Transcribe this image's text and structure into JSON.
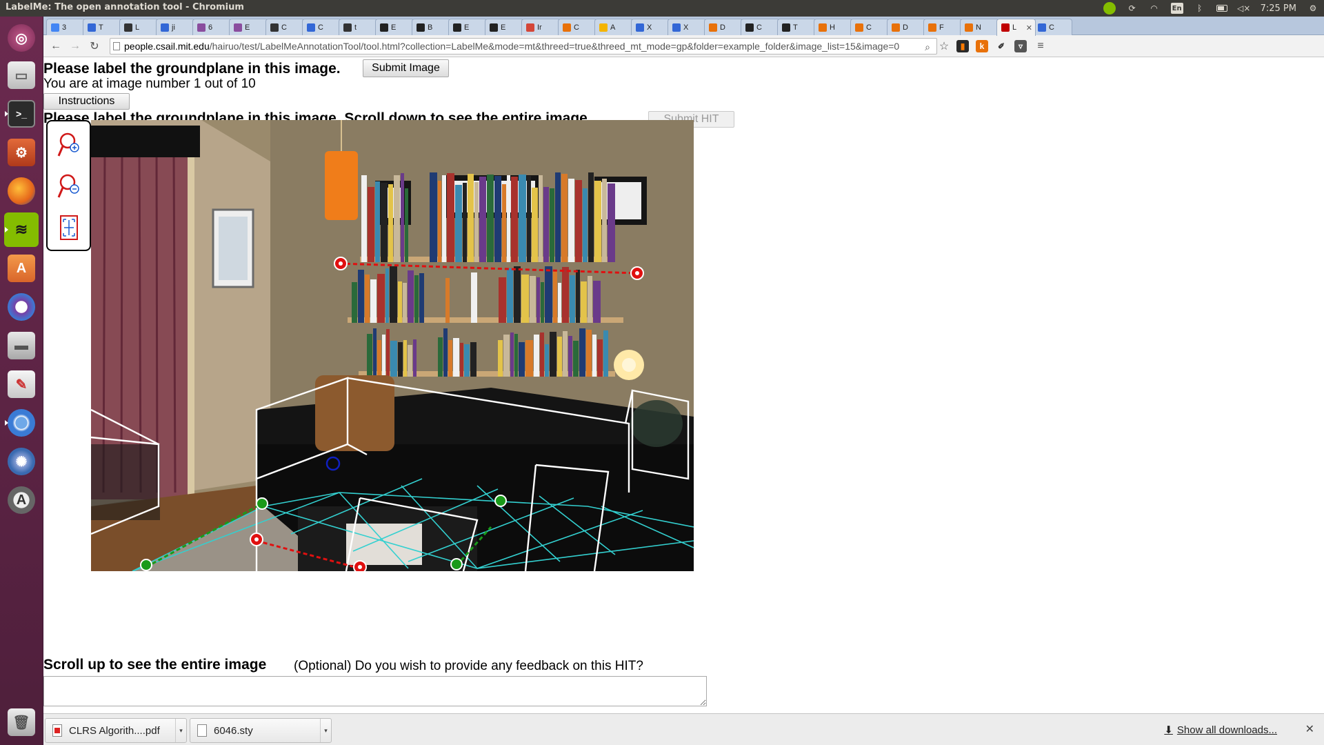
{
  "window": {
    "title": "LabelMe: The open annotation tool - Chromium",
    "clock": "7:25 PM",
    "keyboard_layout": "En"
  },
  "tabs": [
    {
      "label": "3",
      "color": "#4285f4"
    },
    {
      "label": "T",
      "color": "#3367d6"
    },
    {
      "label": "L",
      "color": "#333333"
    },
    {
      "label": "ji",
      "color": "#3367d6"
    },
    {
      "label": "6",
      "color": "#8a4d9e"
    },
    {
      "label": "E",
      "color": "#8a4d9e"
    },
    {
      "label": "C",
      "color": "#333333"
    },
    {
      "label": "C",
      "color": "#3367d6"
    },
    {
      "label": "t",
      "color": "#333333"
    },
    {
      "label": "E",
      "color": "#222222"
    },
    {
      "label": "B",
      "color": "#222222"
    },
    {
      "label": "E",
      "color": "#222222"
    },
    {
      "label": "E",
      "color": "#222222"
    },
    {
      "label": "Ir",
      "color": "#d44638"
    },
    {
      "label": "C",
      "color": "#e8710a"
    },
    {
      "label": "A",
      "color": "#f4b400"
    },
    {
      "label": "X",
      "color": "#3367d6"
    },
    {
      "label": "X",
      "color": "#3367d6"
    },
    {
      "label": "D",
      "color": "#e8710a"
    },
    {
      "label": "C",
      "color": "#222222"
    },
    {
      "label": "T",
      "color": "#222222"
    },
    {
      "label": "H",
      "color": "#e8710a"
    },
    {
      "label": "C",
      "color": "#e8710a"
    },
    {
      "label": "D",
      "color": "#e8710a"
    },
    {
      "label": "F",
      "color": "#e8710a"
    },
    {
      "label": "N",
      "color": "#e8710a"
    },
    {
      "label": "L",
      "color": "#c00000",
      "active": true
    },
    {
      "label": "C",
      "color": "#3367d6"
    }
  ],
  "omnibox": {
    "host": "people.csail.mit.edu",
    "path": "/hairuo/test/LabelMeAnnotationTool/tool.html?collection=LabelMe&mode=mt&threed=true&threed_mt_mode=gp&folder=example_folder&image_list=15&image=0"
  },
  "page": {
    "title": "Please label the groundplane in this image.",
    "submit_image": "Submit Image",
    "progress_text": "You are at image number 1 out of 10",
    "instructions": "Instructions",
    "heading2": "Please label the groundplane in this image. Scroll down to see the entire image.",
    "submit_hit": "Submit HIT",
    "scroll_up": "Scroll up to see the entire image",
    "feedback_question": "(Optional) Do you wish to provide any feedback on this HIT?",
    "feedback_value": ""
  },
  "tools": [
    {
      "name": "zoom-in-icon"
    },
    {
      "name": "zoom-out-icon"
    },
    {
      "name": "fit-image-icon"
    }
  ],
  "colors": {
    "groundplane_grid": "#33d0d0",
    "box_outline": "#ffffff",
    "point_red": "#e01010",
    "point_green": "#1a9a1a",
    "point_blue": "#1020c0"
  },
  "downloads": [
    {
      "name": "CLRS Algorith....pdf",
      "type": "pdf"
    },
    {
      "name": "6046.sty",
      "type": "file"
    }
  ],
  "downloads_show_all": "Show all downloads..."
}
